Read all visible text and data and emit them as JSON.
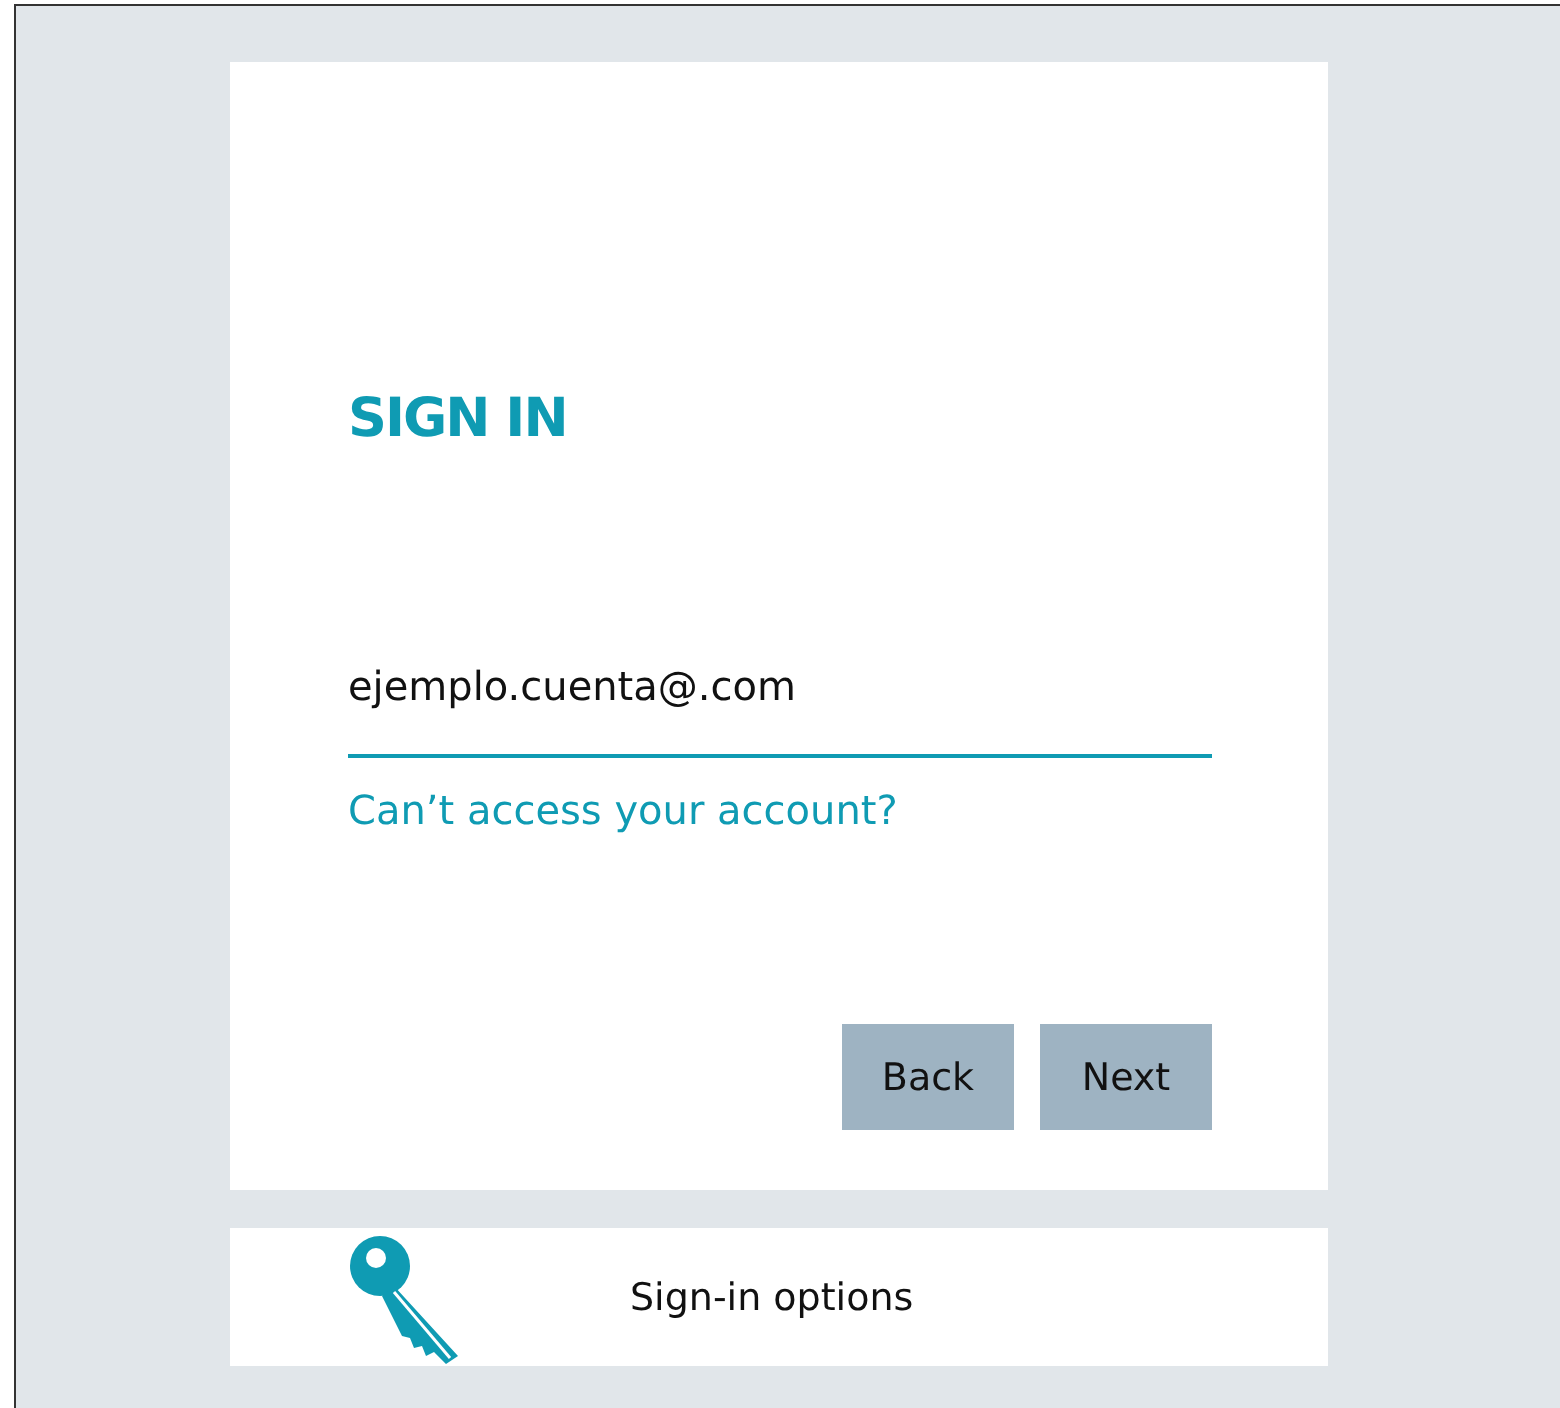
{
  "title": "SIGN IN",
  "account_field": {
    "value": "ejemplo.cuenta@.com"
  },
  "help_link": "Can’t access your account?",
  "buttons": [
    "Back",
    "Next"
  ],
  "sign_in_options": {
    "label": "Sign-in options"
  }
}
